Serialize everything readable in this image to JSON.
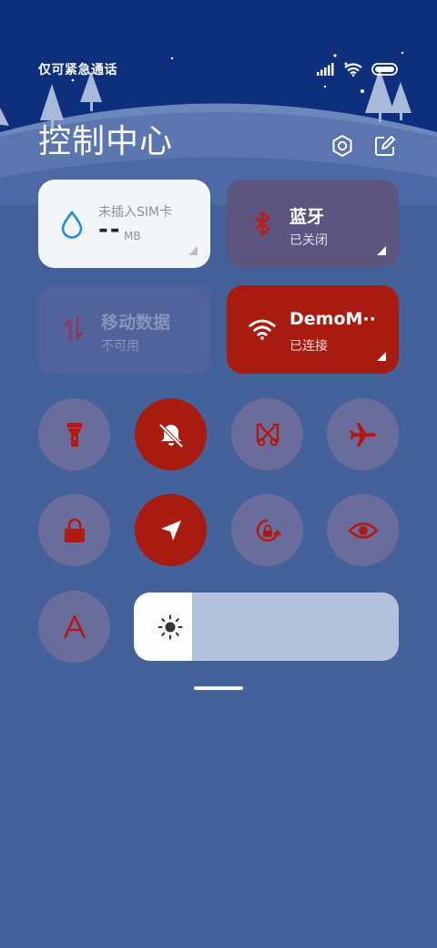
{
  "status_bar": {
    "carrier_text": "仅可紧急通话",
    "icons": [
      "signal-icon",
      "wifi-icon",
      "battery-icon"
    ]
  },
  "header": {
    "title": "控制中心",
    "buttons": [
      "settings-icon",
      "edit-icon"
    ]
  },
  "tiles": {
    "sim": {
      "label": "未插入SIM卡",
      "value": "--",
      "unit": "MB",
      "icon": "water-drop-icon"
    },
    "bluetooth": {
      "title": "蓝牙",
      "status": "已关闭",
      "icon": "bluetooth-icon"
    },
    "mobile_data": {
      "title": "移动数据",
      "status": "不可用",
      "icon": "data-arrows-icon"
    },
    "wifi": {
      "title": "DemoM··",
      "status": "已连接",
      "icon": "wifi-icon"
    }
  },
  "toggles": [
    {
      "name": "flashlight",
      "icon": "flashlight-icon",
      "active": false
    },
    {
      "name": "mute",
      "icon": "bell-off-icon",
      "active": true
    },
    {
      "name": "screenshot",
      "icon": "scissors-icon",
      "active": false
    },
    {
      "name": "airplane-mode",
      "icon": "airplane-icon",
      "active": false
    },
    {
      "name": "lock-screen",
      "icon": "lock-icon",
      "active": false
    },
    {
      "name": "location",
      "icon": "navigation-arrow-icon",
      "active": true
    },
    {
      "name": "auto-rotate",
      "icon": "rotation-lock-icon",
      "active": false
    },
    {
      "name": "reading-mode",
      "icon": "eye-icon",
      "active": false
    },
    {
      "name": "font-size",
      "icon": "letter-a-icon",
      "active": false
    }
  ],
  "brightness": {
    "level_percent": 22,
    "icon": "sun-icon"
  },
  "colors": {
    "active": "#a81b10",
    "inactive": "#6a6d9c",
    "background": "#45619a"
  }
}
